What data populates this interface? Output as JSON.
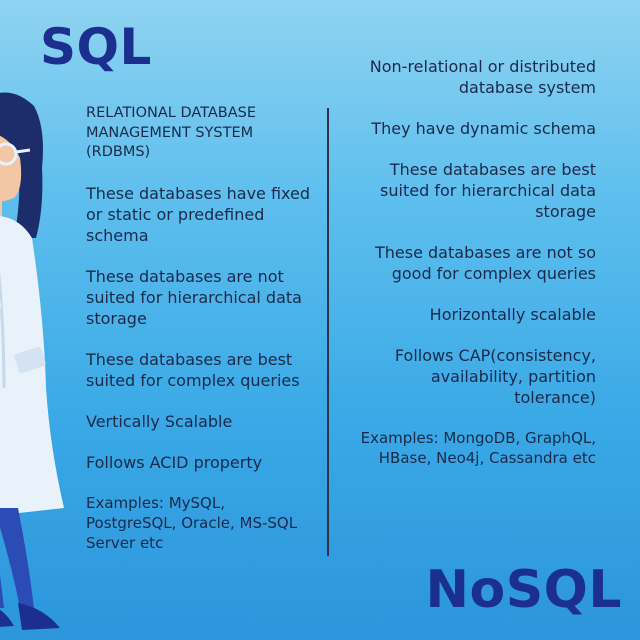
{
  "titles": {
    "sql": "SQL",
    "nosql": "NoSQL"
  },
  "sql_points": [
    "RELATIONAL DATABASE MANAGEMENT SYSTEM (RDBMS)",
    "These databases have fixed or static or predefined schema",
    "These databases are not suited for hierarchical data storage",
    "These databases are best suited for complex queries",
    "Vertically Scalable",
    "Follows ACID property",
    "Examples: MySQL, PostgreSQL, Oracle, MS-SQL Server etc"
  ],
  "nosql_points": [
    "Non-relational or distributed database system",
    "They have dynamic schema",
    "These databases are best suited for hierarchical data storage",
    "These databases are not so good for complex queries",
    "Horizontally scalable",
    "Follows CAP(consistency, availability, partition tolerance)",
    "Examples: MongoDB, GraphQL, HBase, Neo4j, Cassandra etc"
  ],
  "colors": {
    "title": "#1b2f8f",
    "text": "#1b2a4a",
    "bg_top": "#8fd3f1",
    "bg_bottom": "#2c95dc"
  },
  "illustration": "scientist-woman-in-lab-coat"
}
